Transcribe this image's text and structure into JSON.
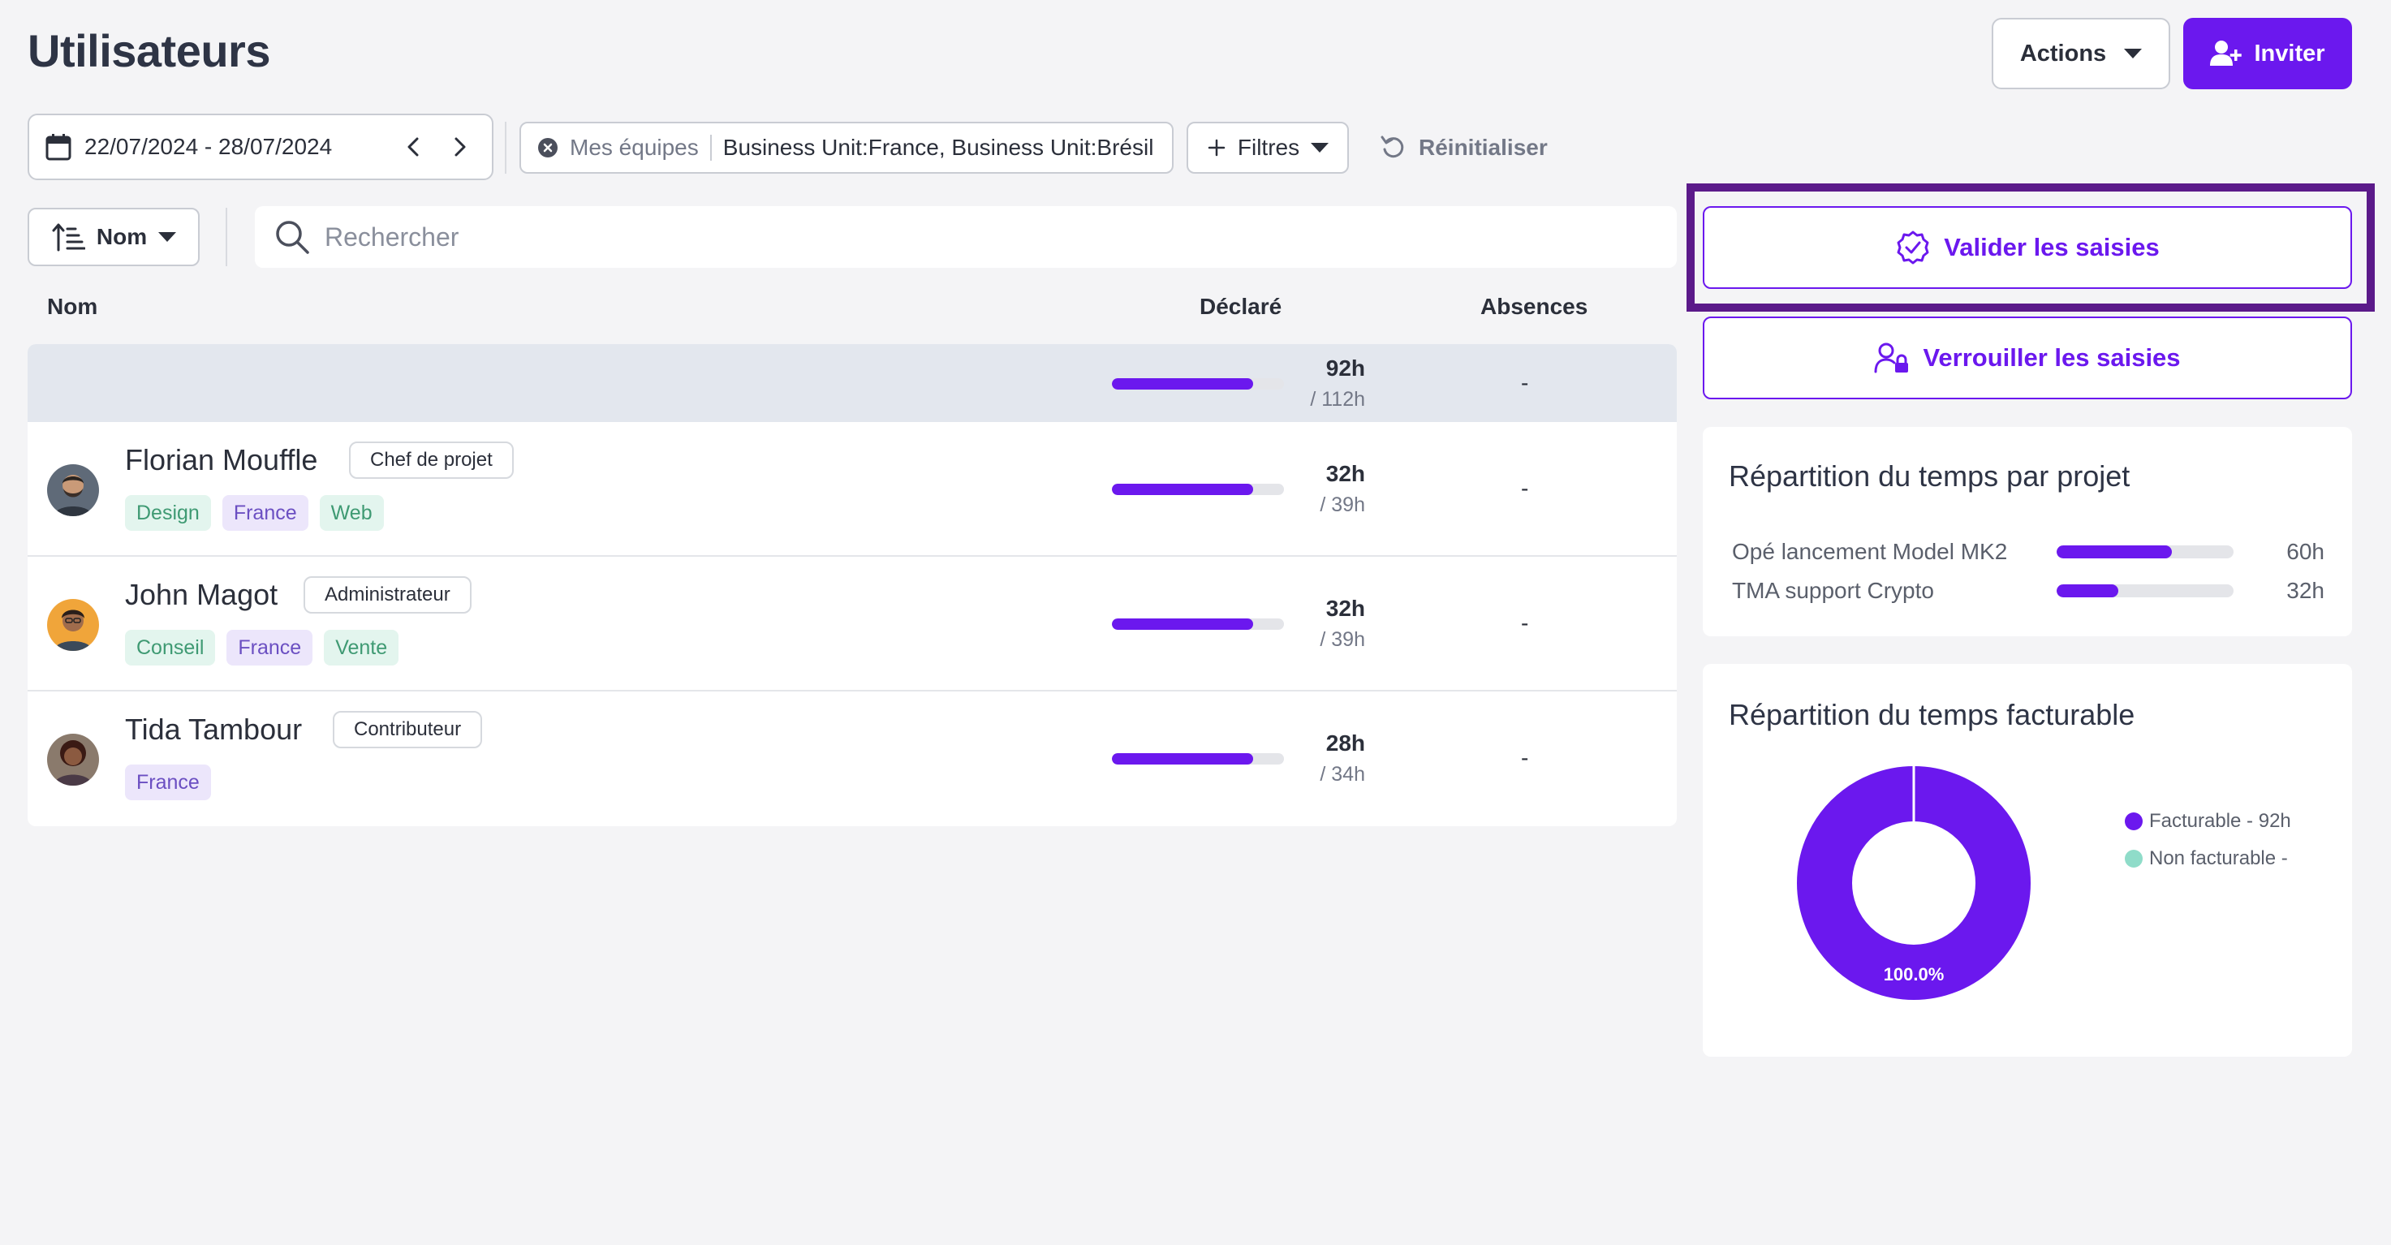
{
  "page": {
    "title": "Utilisateurs"
  },
  "toolbar": {
    "actions_label": "Actions",
    "invite_label": "Inviter",
    "date_range": "22/07/2024 - 28/07/2024",
    "team_filter_prefix": "Mes équipes",
    "team_filter_value": "Business Unit:France, Business Unit:Brésil",
    "filters_label": "Filtres",
    "reset_label": "Réinitialiser",
    "sort_label": "Nom",
    "search_placeholder": "Rechercher"
  },
  "table": {
    "headers": {
      "name": "Nom",
      "declared": "Déclaré",
      "absences": "Absences"
    },
    "total": {
      "declared": "92h",
      "expected": "/ 112h",
      "progress": 0.82,
      "absences": "-"
    },
    "rows": [
      {
        "name": "Florian Mouffle",
        "role": "Chef de projet",
        "tags": [
          "Design",
          "France",
          "Web"
        ],
        "declared": "32h",
        "expected": "/ 39h",
        "progress": 0.82,
        "absences": "-"
      },
      {
        "name": "John Magot",
        "role": "Administrateur",
        "tags": [
          "Conseil",
          "France",
          "Vente"
        ],
        "declared": "32h",
        "expected": "/ 39h",
        "progress": 0.82,
        "absences": "-"
      },
      {
        "name": "Tida Tambour",
        "role": "Contributeur",
        "tags": [
          "France"
        ],
        "declared": "28h",
        "expected": "/ 34h",
        "progress": 0.82,
        "absences": "-"
      }
    ]
  },
  "side": {
    "validate_label": "Valider les saisies",
    "lock_label": "Verrouiller les saisies",
    "project_panel": {
      "title": "Répartition du temps par projet",
      "projects": [
        {
          "name": "Opé lancement Model MK2",
          "value": "60h",
          "fraction": 0.65
        },
        {
          "name": "TMA support Crypto",
          "value": "32h",
          "fraction": 0.35
        }
      ]
    },
    "billable_panel": {
      "title": "Répartition du temps facturable",
      "legend": [
        {
          "label": "Facturable - 92h",
          "color": "#6b18ee"
        },
        {
          "label": "Non facturable -",
          "color": "#8fdcc9"
        }
      ],
      "center_label": "100.0%"
    }
  },
  "colors": {
    "accent": "#6b18ee",
    "highlight": "#5b1a8a",
    "tag_green": "#3f9a73",
    "tag_purple": "#6b4fc2"
  },
  "chart_data": {
    "type": "pie",
    "title": "Répartition du temps facturable",
    "categories": [
      "Facturable",
      "Non facturable"
    ],
    "values": [
      92,
      0
    ],
    "labels": [
      "100.0%"
    ]
  }
}
